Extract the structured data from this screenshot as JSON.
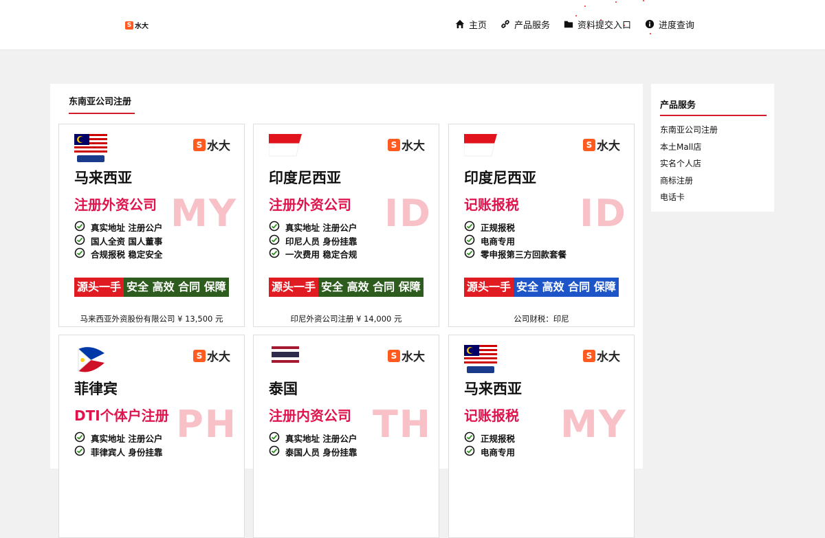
{
  "header": {
    "logo_text": "水大",
    "nav": [
      {
        "label": "主页",
        "icon": "home-icon"
      },
      {
        "label": "产品服务",
        "icon": "link-icon"
      },
      {
        "label": "资料提交入口",
        "icon": "folder-icon"
      },
      {
        "label": "进度查询",
        "icon": "info-icon"
      }
    ]
  },
  "main": {
    "title": "东南亚公司注册",
    "cards": [
      {
        "flag": "MALAYSIA",
        "brand": "水大",
        "country": "马来西亚",
        "service": "注册外资公司",
        "code": "MY",
        "features": [
          "真实地址 注册公户",
          "国人全资 国人董事",
          "合规报税 稳定安全"
        ],
        "banner_a": "源头一手",
        "banner_b": "安全 高效 合同 保障",
        "caption": "马来西亚外资股份有限公司 ¥ 13,500 元"
      },
      {
        "flag": "INDONESIA",
        "brand": "水大",
        "country": "印度尼西亚",
        "service": "注册外资公司",
        "code": "ID",
        "features": [
          "真实地址 注册公户",
          "印尼人员 身份挂靠",
          "一次费用 稳定合规"
        ],
        "banner_a": "源头一手",
        "banner_b": "安全 高效 合同 保障",
        "caption": "印尼外资公司注册 ¥ 14,000 元"
      },
      {
        "flag": "INDONESIA",
        "brand": "水大",
        "country": "印度尼西亚",
        "service": "记账报税",
        "code": "ID",
        "features": [
          "正规报税",
          "电商专用",
          "零申报第三方回款套餐"
        ],
        "banner_a": "源头一手",
        "banner_b": "安全 高效 合同 保障",
        "caption": "公司财税：印尼"
      },
      {
        "flag": "Philippines",
        "brand": "水大",
        "country": "菲律宾",
        "service": "DTI个体户注册",
        "code": "PH",
        "features": [
          "真实地址 注册公户",
          "菲律宾人 身份挂靠"
        ],
        "banner_a": "",
        "banner_b": "",
        "caption": ""
      },
      {
        "flag": "Thailand",
        "brand": "水大",
        "country": "泰国",
        "service": "注册内资公司",
        "code": "TH",
        "features": [
          "真实地址 注册公户",
          "泰国人员 身份挂靠"
        ],
        "banner_a": "",
        "banner_b": "",
        "caption": ""
      },
      {
        "flag": "MALAYSIA",
        "brand": "水大",
        "country": "马来西亚",
        "service": "记账报税",
        "code": "MY",
        "features": [
          "正规报税",
          "电商专用"
        ],
        "banner_a": "",
        "banner_b": "",
        "caption": ""
      }
    ]
  },
  "sidebar": {
    "title": "产品服务",
    "items": [
      "东南亚公司注册",
      "本土Mall店",
      "实名个人店",
      "商标注册",
      "电话卡"
    ]
  },
  "colors": {
    "accent": "#d11a2a",
    "service_red": "#e0144c",
    "brand_orange": "#ff5a1f"
  }
}
